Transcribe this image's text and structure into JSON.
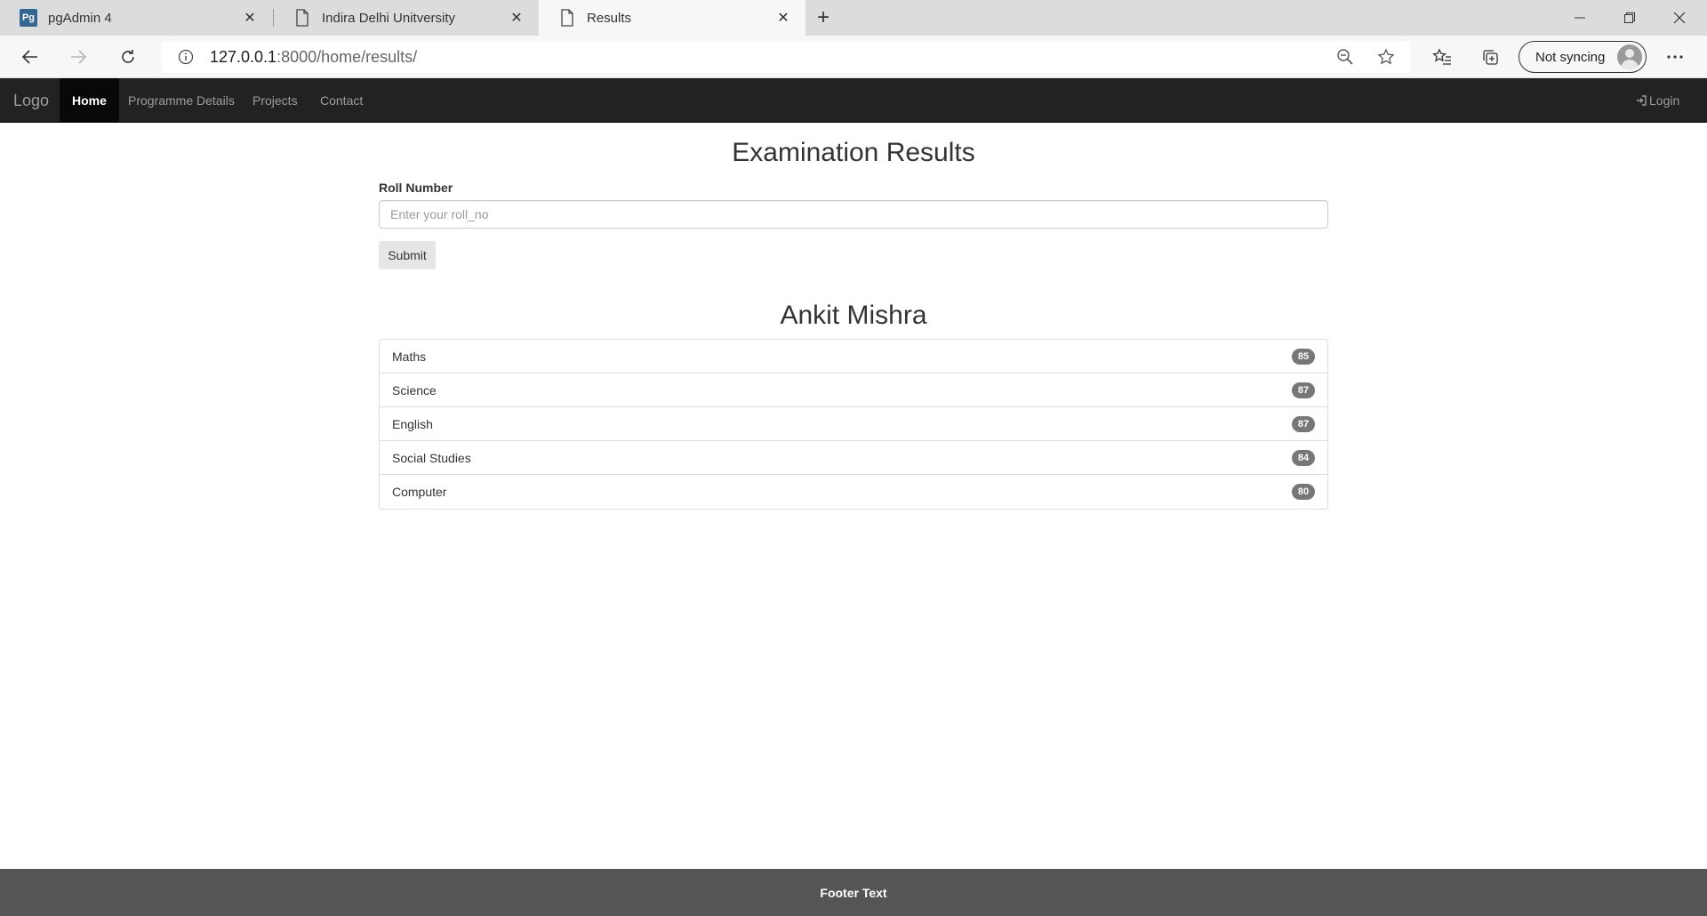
{
  "browser": {
    "tabs": [
      {
        "title": "pgAdmin 4",
        "favicon": "pgadmin-logo-icon"
      },
      {
        "title": "Indira Delhi Unitversity",
        "favicon": "page-icon"
      },
      {
        "title": "Results",
        "favicon": "page-icon",
        "active": true
      }
    ],
    "url_host": "127.0.0.1",
    "url_path": ":8000/home/results/",
    "sync_label": "Not syncing"
  },
  "navbar": {
    "brand": "Logo",
    "items": [
      "Home",
      "Programme Details",
      "Projects",
      "Contact"
    ],
    "active": "Home",
    "login": "Login"
  },
  "main": {
    "title": "Examination Results",
    "roll_label": "Roll Number",
    "roll_placeholder": "Enter your roll_no",
    "submit": "Submit",
    "student_name": "Ankit Mishra",
    "subjects": [
      {
        "name": "Maths",
        "score": "85"
      },
      {
        "name": "Science",
        "score": "87"
      },
      {
        "name": "English",
        "score": "87"
      },
      {
        "name": "Social Studies",
        "score": "84"
      },
      {
        "name": "Computer",
        "score": "80"
      }
    ]
  },
  "footer": {
    "text": "Footer Text"
  },
  "colors": {
    "navbar": "#222222",
    "footer": "#555555",
    "badge": "#777777"
  }
}
